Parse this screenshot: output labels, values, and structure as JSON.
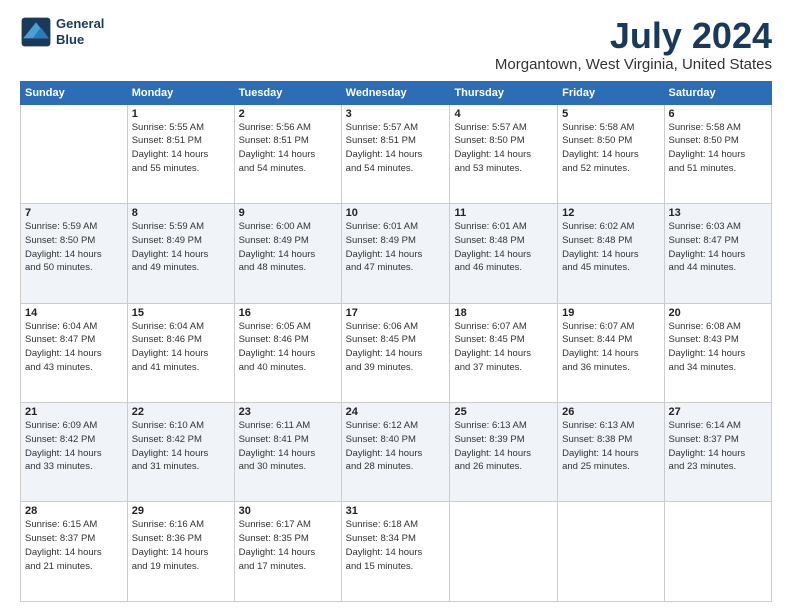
{
  "logo": {
    "line1": "General",
    "line2": "Blue"
  },
  "title": "July 2024",
  "subtitle": "Morgantown, West Virginia, United States",
  "weekdays": [
    "Sunday",
    "Monday",
    "Tuesday",
    "Wednesday",
    "Thursday",
    "Friday",
    "Saturday"
  ],
  "weeks": [
    [
      {
        "day": "",
        "info": ""
      },
      {
        "day": "1",
        "info": "Sunrise: 5:55 AM\nSunset: 8:51 PM\nDaylight: 14 hours\nand 55 minutes."
      },
      {
        "day": "2",
        "info": "Sunrise: 5:56 AM\nSunset: 8:51 PM\nDaylight: 14 hours\nand 54 minutes."
      },
      {
        "day": "3",
        "info": "Sunrise: 5:57 AM\nSunset: 8:51 PM\nDaylight: 14 hours\nand 54 minutes."
      },
      {
        "day": "4",
        "info": "Sunrise: 5:57 AM\nSunset: 8:50 PM\nDaylight: 14 hours\nand 53 minutes."
      },
      {
        "day": "5",
        "info": "Sunrise: 5:58 AM\nSunset: 8:50 PM\nDaylight: 14 hours\nand 52 minutes."
      },
      {
        "day": "6",
        "info": "Sunrise: 5:58 AM\nSunset: 8:50 PM\nDaylight: 14 hours\nand 51 minutes."
      }
    ],
    [
      {
        "day": "7",
        "info": "Sunrise: 5:59 AM\nSunset: 8:50 PM\nDaylight: 14 hours\nand 50 minutes."
      },
      {
        "day": "8",
        "info": "Sunrise: 5:59 AM\nSunset: 8:49 PM\nDaylight: 14 hours\nand 49 minutes."
      },
      {
        "day": "9",
        "info": "Sunrise: 6:00 AM\nSunset: 8:49 PM\nDaylight: 14 hours\nand 48 minutes."
      },
      {
        "day": "10",
        "info": "Sunrise: 6:01 AM\nSunset: 8:49 PM\nDaylight: 14 hours\nand 47 minutes."
      },
      {
        "day": "11",
        "info": "Sunrise: 6:01 AM\nSunset: 8:48 PM\nDaylight: 14 hours\nand 46 minutes."
      },
      {
        "day": "12",
        "info": "Sunrise: 6:02 AM\nSunset: 8:48 PM\nDaylight: 14 hours\nand 45 minutes."
      },
      {
        "day": "13",
        "info": "Sunrise: 6:03 AM\nSunset: 8:47 PM\nDaylight: 14 hours\nand 44 minutes."
      }
    ],
    [
      {
        "day": "14",
        "info": "Sunrise: 6:04 AM\nSunset: 8:47 PM\nDaylight: 14 hours\nand 43 minutes."
      },
      {
        "day": "15",
        "info": "Sunrise: 6:04 AM\nSunset: 8:46 PM\nDaylight: 14 hours\nand 41 minutes."
      },
      {
        "day": "16",
        "info": "Sunrise: 6:05 AM\nSunset: 8:46 PM\nDaylight: 14 hours\nand 40 minutes."
      },
      {
        "day": "17",
        "info": "Sunrise: 6:06 AM\nSunset: 8:45 PM\nDaylight: 14 hours\nand 39 minutes."
      },
      {
        "day": "18",
        "info": "Sunrise: 6:07 AM\nSunset: 8:45 PM\nDaylight: 14 hours\nand 37 minutes."
      },
      {
        "day": "19",
        "info": "Sunrise: 6:07 AM\nSunset: 8:44 PM\nDaylight: 14 hours\nand 36 minutes."
      },
      {
        "day": "20",
        "info": "Sunrise: 6:08 AM\nSunset: 8:43 PM\nDaylight: 14 hours\nand 34 minutes."
      }
    ],
    [
      {
        "day": "21",
        "info": "Sunrise: 6:09 AM\nSunset: 8:42 PM\nDaylight: 14 hours\nand 33 minutes."
      },
      {
        "day": "22",
        "info": "Sunrise: 6:10 AM\nSunset: 8:42 PM\nDaylight: 14 hours\nand 31 minutes."
      },
      {
        "day": "23",
        "info": "Sunrise: 6:11 AM\nSunset: 8:41 PM\nDaylight: 14 hours\nand 30 minutes."
      },
      {
        "day": "24",
        "info": "Sunrise: 6:12 AM\nSunset: 8:40 PM\nDaylight: 14 hours\nand 28 minutes."
      },
      {
        "day": "25",
        "info": "Sunrise: 6:13 AM\nSunset: 8:39 PM\nDaylight: 14 hours\nand 26 minutes."
      },
      {
        "day": "26",
        "info": "Sunrise: 6:13 AM\nSunset: 8:38 PM\nDaylight: 14 hours\nand 25 minutes."
      },
      {
        "day": "27",
        "info": "Sunrise: 6:14 AM\nSunset: 8:37 PM\nDaylight: 14 hours\nand 23 minutes."
      }
    ],
    [
      {
        "day": "28",
        "info": "Sunrise: 6:15 AM\nSunset: 8:37 PM\nDaylight: 14 hours\nand 21 minutes."
      },
      {
        "day": "29",
        "info": "Sunrise: 6:16 AM\nSunset: 8:36 PM\nDaylight: 14 hours\nand 19 minutes."
      },
      {
        "day": "30",
        "info": "Sunrise: 6:17 AM\nSunset: 8:35 PM\nDaylight: 14 hours\nand 17 minutes."
      },
      {
        "day": "31",
        "info": "Sunrise: 6:18 AM\nSunset: 8:34 PM\nDaylight: 14 hours\nand 15 minutes."
      },
      {
        "day": "",
        "info": ""
      },
      {
        "day": "",
        "info": ""
      },
      {
        "day": "",
        "info": ""
      }
    ]
  ]
}
